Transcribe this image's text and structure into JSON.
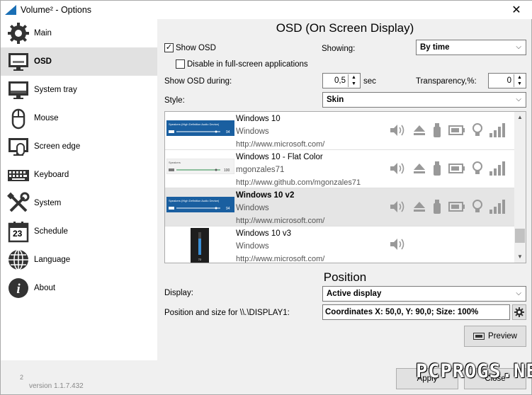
{
  "window": {
    "title": "Volume² - Options",
    "close": "✕"
  },
  "sidebar": {
    "items": [
      {
        "label": "Main",
        "icon": "gear-icon"
      },
      {
        "label": "OSD",
        "icon": "monitor-icon"
      },
      {
        "label": "System tray",
        "icon": "tray-icon"
      },
      {
        "label": "Mouse",
        "icon": "mouse-icon"
      },
      {
        "label": "Screen edge",
        "icon": "screen-edge-icon"
      },
      {
        "label": "Keyboard",
        "icon": "keyboard-icon"
      },
      {
        "label": "System",
        "icon": "tools-icon"
      },
      {
        "label": "Schedule",
        "icon": "calendar-icon"
      },
      {
        "label": "Language",
        "icon": "globe-icon"
      },
      {
        "label": "About",
        "icon": "info-icon"
      }
    ],
    "schedule_day": "23",
    "version": "version 1.1.7.432",
    "sup": "2"
  },
  "osd": {
    "heading": "OSD (On Screen Display)",
    "show_osd": {
      "label": "Show OSD",
      "checked": true
    },
    "disable_fullscreen": {
      "label": "Disable in full-screen applications",
      "checked": false
    },
    "showing": {
      "label": "Showing:",
      "value": "By time"
    },
    "show_during": {
      "label": "Show OSD during:",
      "value": "0,5",
      "unit": "sec"
    },
    "transparency": {
      "label": "Transparency,%:",
      "value": "0"
    },
    "style": {
      "label": "Style:",
      "value": "Skin"
    }
  },
  "skins": [
    {
      "name": "Windows 10",
      "author": "Windows",
      "url": "http://www.microsoft.com/",
      "thumb_title": "Speakers (High Definition Audio Device)",
      "thumb_value": "94"
    },
    {
      "name": "Windows 10 - Flat Color",
      "author": "mgonzales71",
      "url": "http://www.github.com/mgonzales71",
      "thumb_title": "Speakers",
      "thumb_value": "100"
    },
    {
      "name": "Windows 10 v2",
      "author": "Windows",
      "url": "http://www.microsoft.com/",
      "thumb_title": "Speakers (High Definition Audio Device)",
      "thumb_value": "94"
    },
    {
      "name": "Windows 10 v3",
      "author": "Windows",
      "url": "http://www.microsoft.com/",
      "thumb_value": "72"
    }
  ],
  "position": {
    "heading": "Position",
    "display": {
      "label": "Display:",
      "value": "Active display"
    },
    "pos_size": {
      "label": "Position and size for \\\\.\\DISPLAY1:",
      "value": "Coordinates X: 50,0, Y: 90,0; Size: 100%"
    },
    "preview": "Preview"
  },
  "footer": {
    "apply": "Apply",
    "close": "Close"
  },
  "watermark": "PCPROGS.NET",
  "colors": {
    "accent": "#1a6fb5",
    "selected": "#e5e5e5"
  }
}
